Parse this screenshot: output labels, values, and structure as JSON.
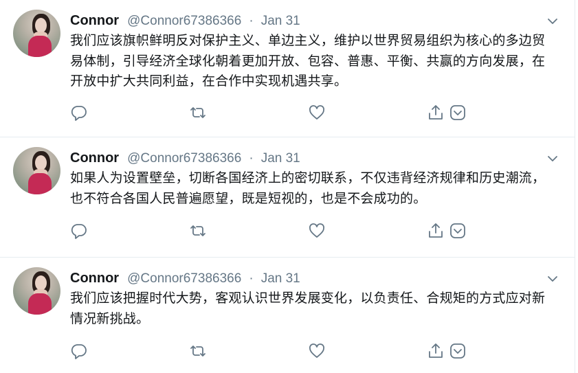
{
  "tweets": [
    {
      "author": {
        "name": "Connor",
        "handle": "@Connor67386366"
      },
      "separator": "·",
      "date": "Jan 31",
      "text": "我们应该旗帜鲜明反对保护主义、单边主义，维护以世界贸易组织为核心的多边贸易体制，引导经济全球化朝着更加开放、包容、普惠、平衡、共赢的方向发展，在开放中扩大共同利益，在合作中实现机遇共享。"
    },
    {
      "author": {
        "name": "Connor",
        "handle": "@Connor67386366"
      },
      "separator": "·",
      "date": "Jan 31",
      "text": "如果人为设置壁垒，切断各国经济上的密切联系，不仅违背经济规律和历史潮流，也不符合各国人民普遍愿望，既是短视的，也是不会成功的。"
    },
    {
      "author": {
        "name": "Connor",
        "handle": "@Connor67386366"
      },
      "separator": "·",
      "date": "Jan 31",
      "text": "我们应该把握时代大势，客观认识世界发展变化，以负责任、合规矩的方式应对新情况新挑战。"
    }
  ],
  "icons": {
    "reply": "reply-icon",
    "retweet": "retweet-icon",
    "like": "like-icon",
    "share": "share-icon",
    "more": "chevron-down-icon",
    "dm": "chevron-down-icon"
  },
  "colors": {
    "icon": "#657786",
    "text": "#14171a",
    "secondary": "#657786",
    "border": "#e6ecf0"
  }
}
